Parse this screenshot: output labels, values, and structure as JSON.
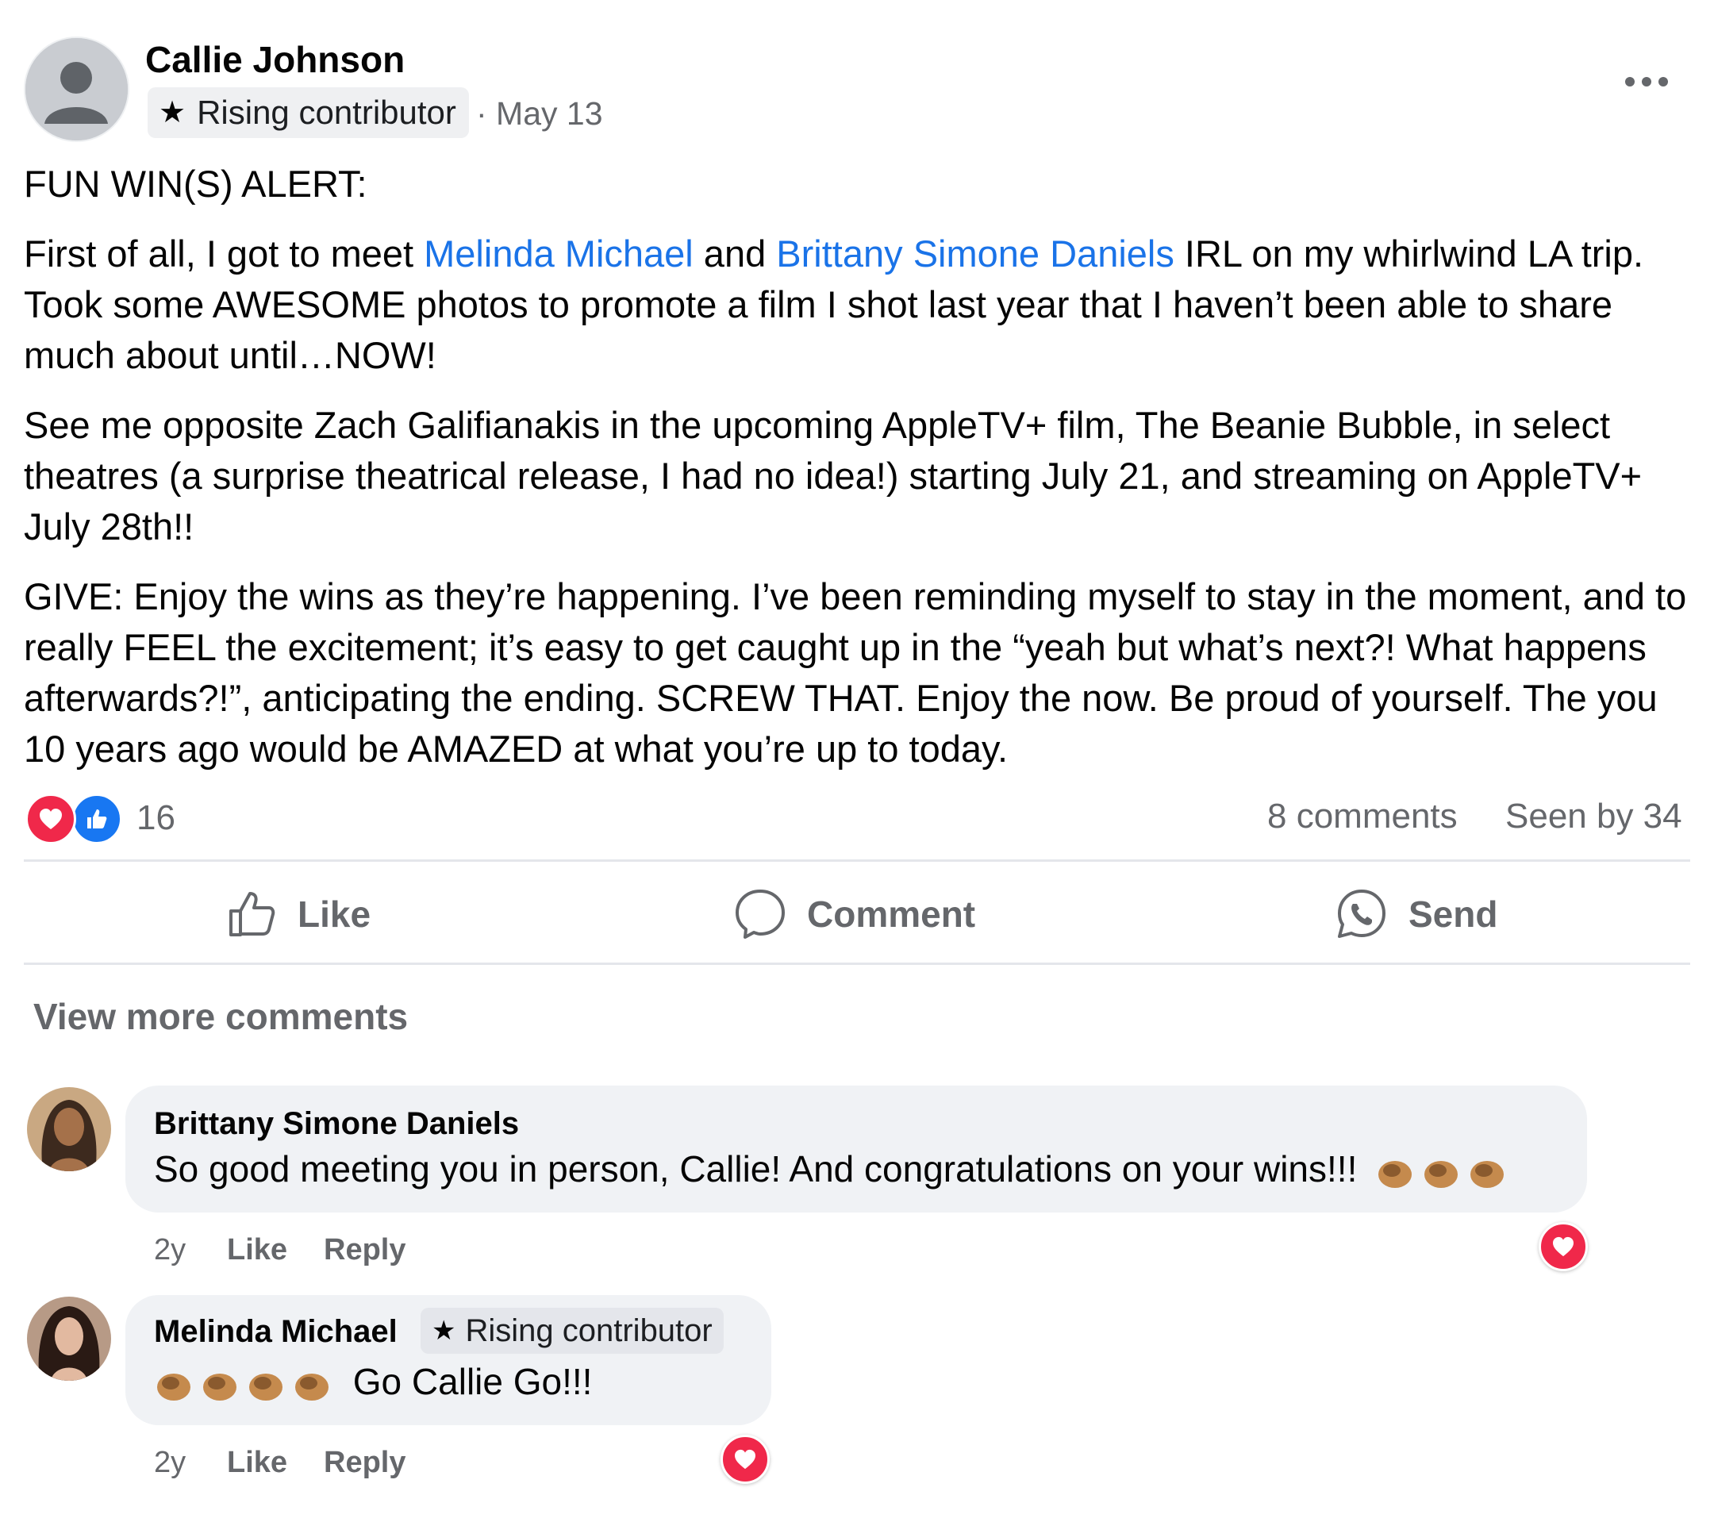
{
  "post": {
    "author": "Callie Johnson",
    "badge": "Rising contributor",
    "date": "· May 13",
    "heading": "FUN WIN(S) ALERT:",
    "p1_a": "First of all, I got to meet ",
    "p1_mention1": "Melinda Michael",
    "p1_b": " and ",
    "p1_mention2": "Brittany Simone Daniels",
    "p1_c": " IRL on my whirlwind LA trip. Took some AWESOME photos to promote a film I shot last year that I haven’t been able to share much about until…NOW!",
    "p2": "See me opposite Zach Galifianakis in the upcoming AppleTV+ film, The Beanie Bubble, in select theatres (a surprise theatrical release, I had no idea!) starting July 21, and streaming on AppleTV+ July 28th!!",
    "p3": "GIVE: Enjoy the wins as they’re happening. I’ve been reminding myself to stay in the moment, and to really FEEL the excitement; it’s easy to get caught up in the “yeah but what’s next?! What happens afterwards?!”, anticipating the ending. SCREW THAT. Enjoy the now. Be proud of yourself. The you 10 years ago would be AMAZED at what you’re up to today."
  },
  "stats": {
    "reaction_count": "16",
    "comments": "8 comments",
    "seen_by": "Seen by 34"
  },
  "actions": {
    "like": "Like",
    "comment": "Comment",
    "send": "Send"
  },
  "view_more": "View more comments",
  "comments": [
    {
      "author": "Brittany Simone Daniels",
      "text": "So good meeting you in person, Callie! And congratulations on your wins!!!",
      "emoji_count": 3,
      "time": "2y",
      "like": "Like",
      "reply": "Reply"
    },
    {
      "author": "Melinda Michael",
      "badge": "Rising contributor",
      "text": "Go Callie Go!!!",
      "emoji_count": 4,
      "time": "2y",
      "like": "Like",
      "reply": "Reply"
    }
  ],
  "icons": {
    "more": "more-options-icon",
    "heart": "heart-reaction-icon",
    "thumb": "like-reaction-icon",
    "comment": "comment-bubble-icon",
    "send": "whatsapp-send-icon",
    "clap": "clapping-hands-emoji"
  },
  "colors": {
    "mention": "#1a73e8",
    "heart": "#f0284a",
    "like": "#1877f2",
    "muted": "#65676b",
    "bubble": "#f0f2f5"
  }
}
